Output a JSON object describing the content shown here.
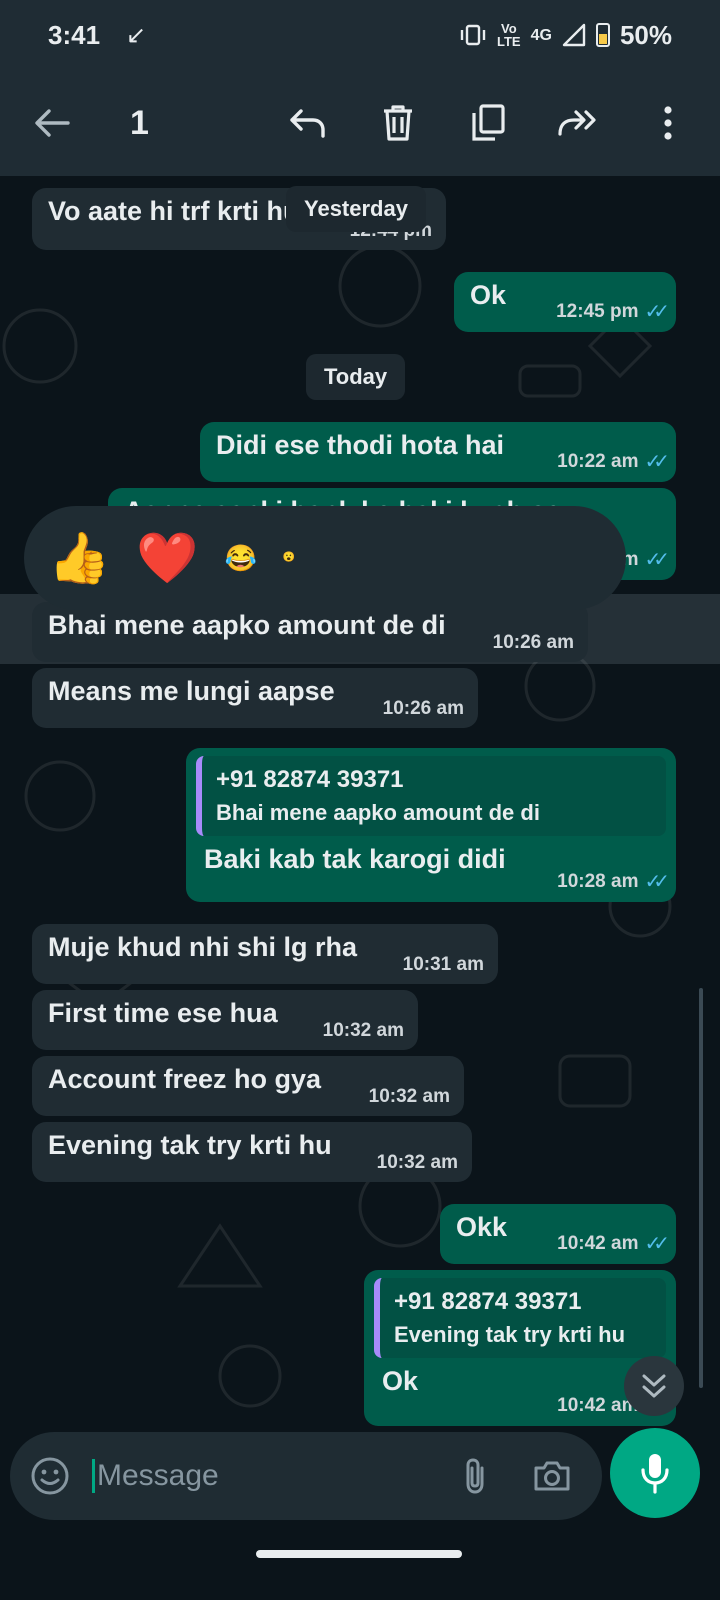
{
  "status_bar": {
    "time": "3:41",
    "arrow": "↙",
    "network_line1": "Vo",
    "network_line2": "LTE",
    "network_type": "4G",
    "battery": "50%"
  },
  "top_bar": {
    "selected_count": "1",
    "icons": [
      "back-arrow-icon",
      "reply-icon",
      "delete-icon",
      "copy-icon",
      "forward-icon",
      "more-icon"
    ]
  },
  "chat": {
    "date_yesterday": "Yesterday",
    "date_today": "Today",
    "messages": [
      {
        "dir": "in",
        "text": "Vo aate hi trf krti hu",
        "time": "12:44 pm"
      },
      {
        "dir": "out",
        "text": "Ok",
        "time": "12:45 pm"
      },
      {
        "dir": "out",
        "text": "Didi ese thodi hota hai",
        "time": "10:22 am"
      },
      {
        "dir": "out",
        "text": "Aapne aapki bank ke baki kuch se",
        "time": "10:23 am"
      },
      {
        "dir": "in",
        "text": "Bhai mene aapko amount de di",
        "time": "10:26 am"
      },
      {
        "dir": "in",
        "text": "Means me lungi aapse",
        "time": "10:26 am"
      },
      {
        "dir": "out",
        "text": "Baki kab tak karogi didi",
        "time": "10:28 am",
        "quote_author": "+91 82874 39371",
        "quote_text": "Bhai mene aapko amount de di"
      },
      {
        "dir": "in",
        "text": "Muje khud nhi shi lg rha",
        "time": "10:31 am"
      },
      {
        "dir": "in",
        "text": "First time ese hua",
        "time": "10:32 am"
      },
      {
        "dir": "in",
        "text": "Account freez ho gya",
        "time": "10:32 am"
      },
      {
        "dir": "in",
        "text": "Evening tak try krti hu",
        "time": "10:32 am"
      },
      {
        "dir": "out",
        "text": "Okk",
        "time": "10:42 am"
      },
      {
        "dir": "out",
        "text": "Ok",
        "time": "10:42 am",
        "quote_author": "+91 82874 39371",
        "quote_text": "Evening tak try krti hu"
      }
    ]
  },
  "reactions": [
    "👍",
    "❤️",
    "😂",
    "😮"
  ],
  "composer": {
    "placeholder": "Message",
    "icons": [
      "emoji-icon",
      "attach-icon",
      "camera-icon",
      "mic-icon"
    ]
  },
  "colors": {
    "background": "#0b141a",
    "incoming": "#202c33",
    "outgoing": "#005c4b",
    "accent": "#00a884",
    "read_ticks": "#53bdeb"
  }
}
